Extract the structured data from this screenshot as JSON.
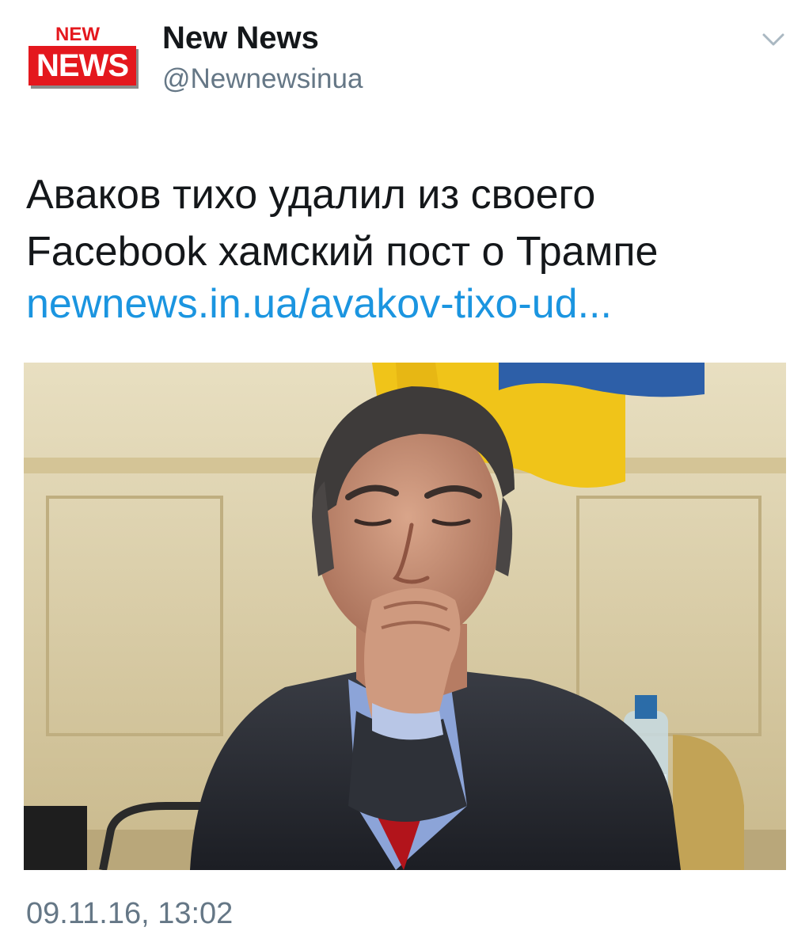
{
  "logo": {
    "top_text": "NEW",
    "box_text": "NEWS"
  },
  "account": {
    "name": "New News",
    "handle": "@Newnewsinua"
  },
  "tweet": {
    "text_lines": [
      "Аваков тихо удалил из своего",
      "Facebook хамский пост о Трампе"
    ],
    "link": "newnews.in.ua/avakov-tixo-ud..."
  },
  "timestamp": "09.11.16, 13:02",
  "icons": {
    "menu": "chevron-down-icon"
  },
  "colors": {
    "brand_red": "#e4181e",
    "link_blue": "#1b95e0",
    "secondary_gray": "#657786"
  }
}
